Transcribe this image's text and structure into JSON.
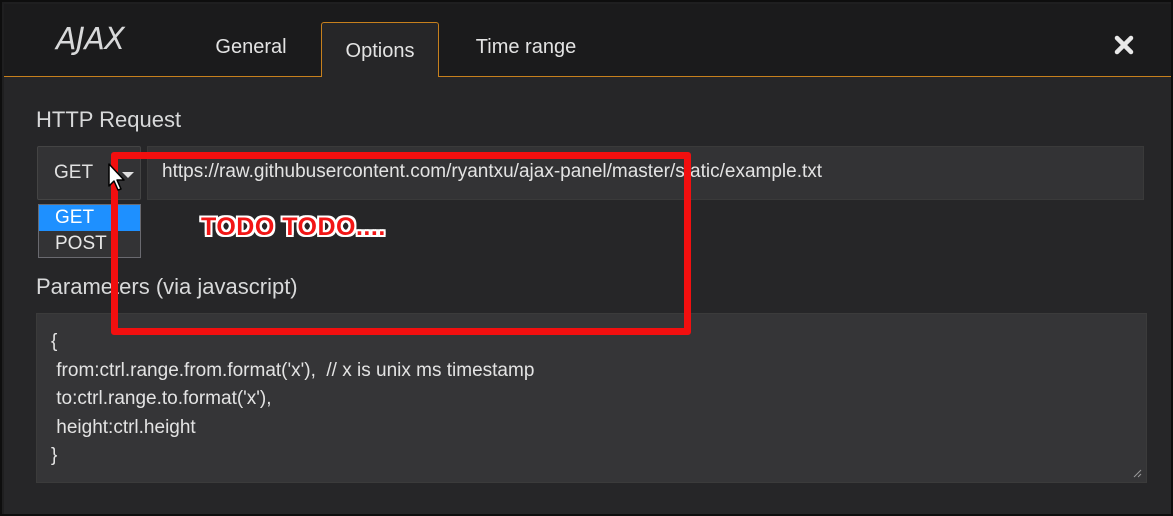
{
  "header": {
    "panel_title": "AJAX",
    "tabs": [
      {
        "label": "General",
        "active": false
      },
      {
        "label": "Options",
        "active": true
      },
      {
        "label": "Time range",
        "active": false
      }
    ],
    "close_icon": "close-x-icon"
  },
  "http_request": {
    "title": "HTTP Request",
    "method_value": "GET",
    "method_options": [
      "GET",
      "POST"
    ],
    "selected_option": "GET",
    "url": "https://raw.githubusercontent.com/ryantxu/ajax-panel/master/static/example.txt"
  },
  "parameters": {
    "title": "Parameters (via javascript)",
    "code": "{\n from:ctrl.range.from.format('x'),  // x is unix ms timestamp\n to:ctrl.range.to.format('x'),\n height:ctrl.height\n}"
  },
  "annotation": {
    "text": "TODO TODO....",
    "color": "#f20f0f"
  },
  "colors": {
    "accent": "#c7801d",
    "selected_option_bg": "#1e90ff",
    "background": "#262628"
  }
}
